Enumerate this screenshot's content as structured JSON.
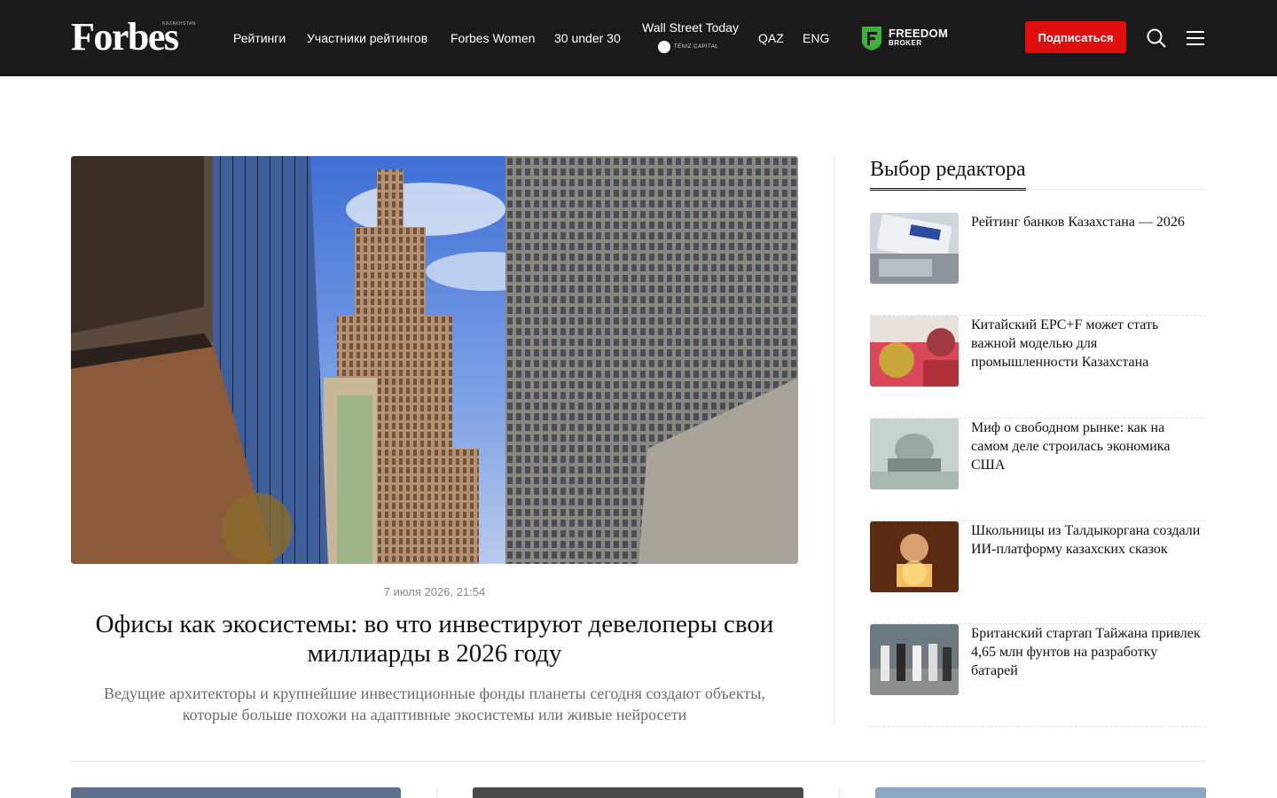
{
  "header": {
    "logo_text": "Forbes",
    "logo_sub": "KAZAKHSTAN",
    "nav": [
      {
        "label": "Рейтинги"
      },
      {
        "label": "Участники рейтингов"
      },
      {
        "label": "Forbes Women"
      },
      {
        "label": "30 under 30"
      }
    ],
    "wall_street": {
      "title": "Wall Street Today",
      "sponsor": "TENIZ CAPITAL"
    },
    "lang": [
      "QAZ",
      "ENG"
    ],
    "partner": {
      "line1": "FREEDOM",
      "line2": "BROKER"
    },
    "subscribe_label": "Подписаться",
    "search_icon": "search-icon",
    "menu_icon": "hamburger-menu-icon"
  },
  "main_article": {
    "date": "7 июля 2026, 21:54",
    "title": "Офисы как экосистемы: во что инвестируют девелоперы свои миллиарды в 2026 году",
    "lead": "Ведущие архитекторы и крупнейшие инвестиционные фонды планеты сегодня создают объекты, которые больше похожи на адаптивные экосистемы или живые нейросети"
  },
  "editors_choice": {
    "heading": "Выбор редактора",
    "items": [
      {
        "title": "Рейтинг банков Казахстана — 2026"
      },
      {
        "title": "Китайский EPC+F может стать важной моделью для промышленности Казахстана"
      },
      {
        "title": "Миф о свободном рынке: как на самом деле строилась экономика США"
      },
      {
        "title": "Школьницы из Талдыкоргана создали ИИ-платформу казахских сказок"
      },
      {
        "title": "Британский стартап Тайжана привлек 4,65 млн фунтов на разработку батарей"
      }
    ]
  },
  "colors": {
    "header_bg": "#1a1a1a",
    "accent_red": "#e00e0e",
    "freedom_green": "#3fae3a"
  }
}
